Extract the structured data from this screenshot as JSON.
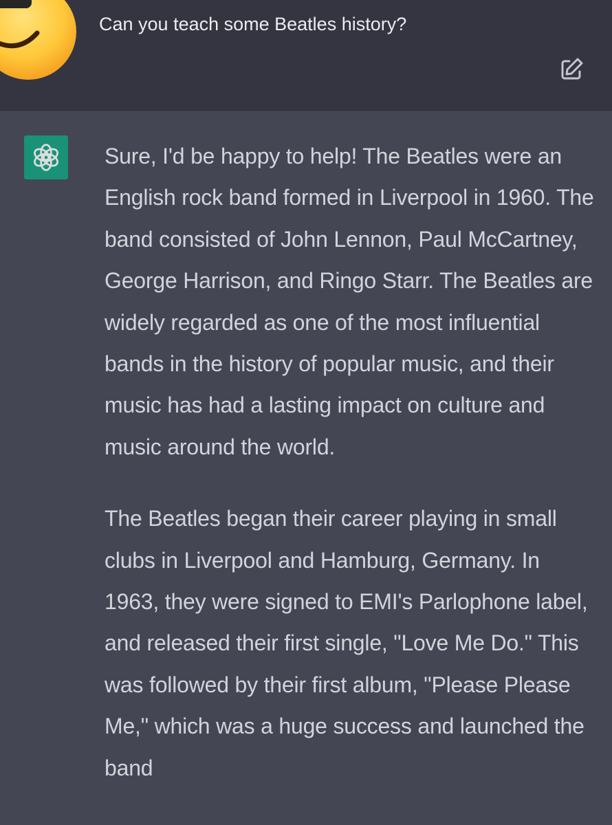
{
  "conversation": {
    "user_message": {
      "text": "Can you teach some Beatles history?",
      "avatar_icon": "sunglasses-emoji-icon",
      "edit_icon": "edit-pencil-icon"
    },
    "assistant_message": {
      "avatar_icon": "openai-logo-icon",
      "paragraphs": [
        "Sure, I'd be happy to help! The Beatles were an English rock band formed in Liverpool in 1960. The band consisted of John Lennon, Paul McCartney, George Harrison, and Ringo Starr. The Beatles are widely regarded as one of the most influential bands in the history of popular music, and their music has had a lasting impact on culture and music around the world.",
        "The Beatles began their career playing in small clubs in Liverpool and Hamburg, Germany. In 1963, they were signed to EMI's Parlophone label, and released their first single, \"Love Me Do.\" This was followed by their first album, \"Please Please Me,\" which was a huge success and launched the band"
      ]
    }
  },
  "colors": {
    "user_bg": "#343541",
    "assistant_bg": "#444654",
    "accent": "#10a37f",
    "text": "#d1d5db"
  }
}
